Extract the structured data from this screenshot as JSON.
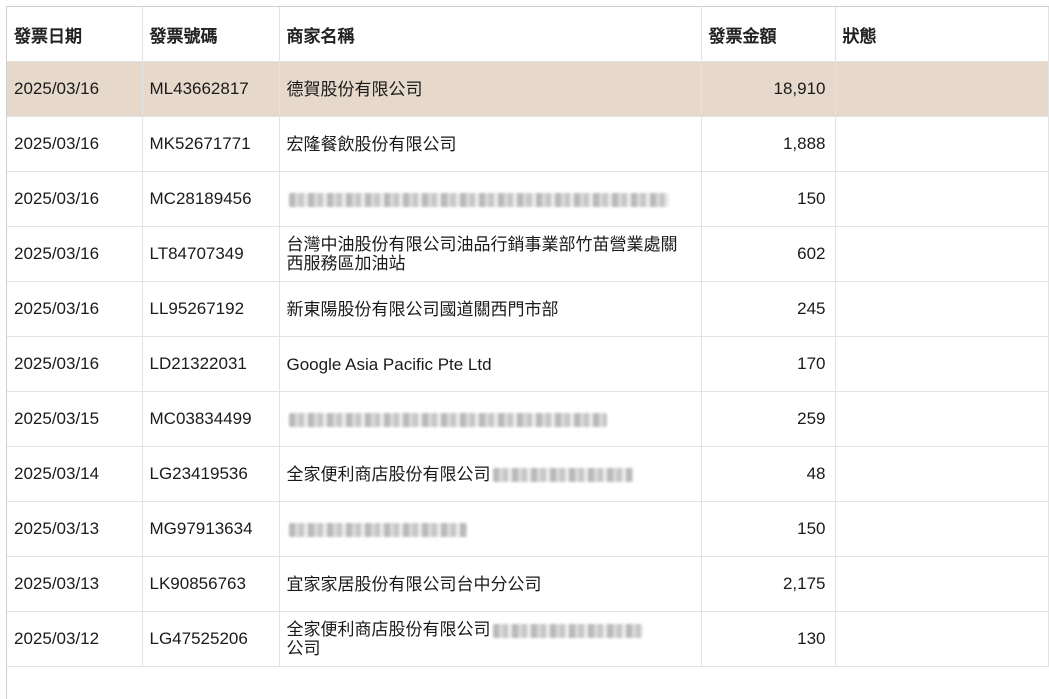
{
  "columns": {
    "date": "發票日期",
    "invoice_no": "發票號碼",
    "merchant": "商家名稱",
    "amount": "發票金額",
    "status": "狀態"
  },
  "rows": [
    {
      "date": "2025/03/16",
      "invoice_no": "ML43662817",
      "merchant": "德賀股份有限公司",
      "amount": "18,910",
      "status": "",
      "selected": true
    },
    {
      "date": "2025/03/16",
      "invoice_no": "MK52671771",
      "merchant": "宏隆餐飲股份有限公司",
      "amount": "1,888",
      "status": ""
    },
    {
      "date": "2025/03/16",
      "invoice_no": "MC28189456",
      "merchant": "",
      "merchant_redacted": true,
      "amount": "150",
      "status": ""
    },
    {
      "date": "2025/03/16",
      "invoice_no": "LT84707349",
      "merchant": "台灣中油股份有限公司油品行銷事業部竹苗營業處關西服務區加油站",
      "amount": "602",
      "status": ""
    },
    {
      "date": "2025/03/16",
      "invoice_no": "LL95267192",
      "merchant": "新東陽股份有限公司國道關西門市部",
      "amount": "245",
      "status": ""
    },
    {
      "date": "2025/03/16",
      "invoice_no": "LD21322031",
      "merchant": "Google Asia Pacific Pte Ltd",
      "amount": "170",
      "status": ""
    },
    {
      "date": "2025/03/15",
      "invoice_no": "MC03834499",
      "merchant": "",
      "merchant_redacted": true,
      "amount": "259",
      "status": ""
    },
    {
      "date": "2025/03/14",
      "invoice_no": "LG23419536",
      "merchant": "全家便利商店股份有限公司",
      "merchant_redacted": true,
      "amount": "48",
      "status": ""
    },
    {
      "date": "2025/03/13",
      "invoice_no": "MG97913634",
      "merchant": "",
      "merchant_redacted": true,
      "amount": "150",
      "status": ""
    },
    {
      "date": "2025/03/13",
      "invoice_no": "LK90856763",
      "merchant": "宜家家居股份有限公司台中分公司",
      "amount": "2,175",
      "status": ""
    },
    {
      "date": "2025/03/12",
      "invoice_no": "LG47525206",
      "merchant": "全家便利商店股份有限公司",
      "merchant_redacted": true,
      "merchant_suffix": "公司",
      "amount": "130",
      "status": ""
    }
  ],
  "colors": {
    "selected_row": "#e6d8cb",
    "grid_line": "#e3e3e3",
    "cut_marker": "#c9a400"
  }
}
